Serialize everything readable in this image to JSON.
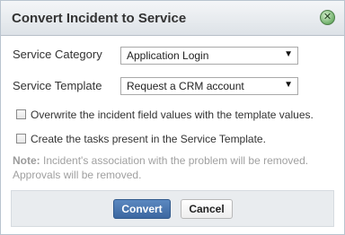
{
  "dialog": {
    "title": "Convert Incident to Service",
    "close_icon": "close-icon",
    "close_symbol": "✕"
  },
  "form": {
    "service_category_label": "Service Category",
    "service_category_value": "Application Login",
    "service_template_label": "Service Template",
    "service_template_value": "Request a CRM account",
    "dropdown_arrow": "▼",
    "overwrite_label": "Overwrite the incident field values with the template values.",
    "overwrite_checked": false,
    "create_tasks_label": "Create the tasks present in the Service Template.",
    "create_tasks_checked": false
  },
  "note": {
    "prefix": "Note:",
    "text": " Incident's association with the problem will be removed.",
    "line2": "Approvals will be removed."
  },
  "footer": {
    "convert_label": "Convert",
    "cancel_label": "Cancel"
  },
  "colors": {
    "primary_button": "#3c67a0",
    "title_bar": "#dde2e7",
    "close_button": "#6fb06a"
  }
}
